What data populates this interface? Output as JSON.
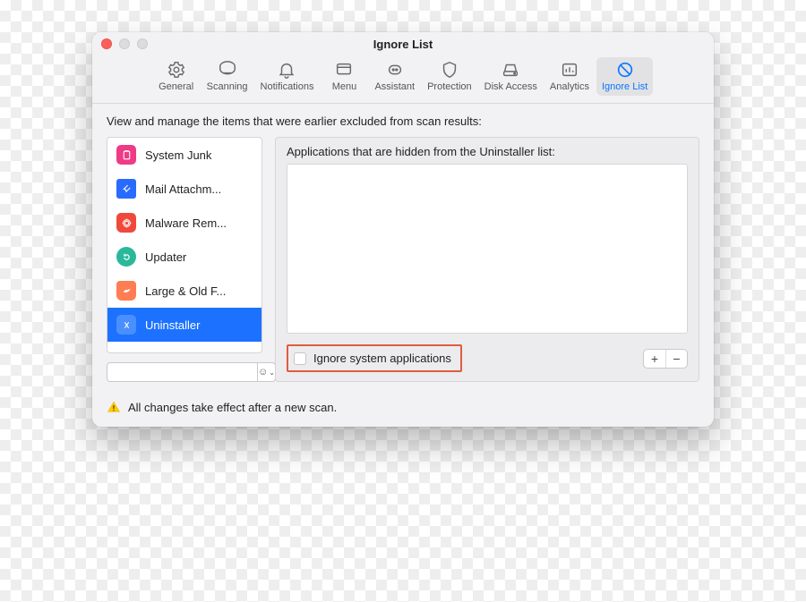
{
  "window": {
    "title": "Ignore List"
  },
  "tabs": [
    {
      "label": "General"
    },
    {
      "label": "Scanning"
    },
    {
      "label": "Notifications"
    },
    {
      "label": "Menu"
    },
    {
      "label": "Assistant"
    },
    {
      "label": "Protection"
    },
    {
      "label": "Disk Access"
    },
    {
      "label": "Analytics"
    },
    {
      "label": "Ignore List"
    }
  ],
  "instructions": "View and manage the items that were earlier excluded from scan results:",
  "sidebar": {
    "items": [
      {
        "label": "System Junk"
      },
      {
        "label": "Mail Attachm..."
      },
      {
        "label": "Malware Rem..."
      },
      {
        "label": "Updater"
      },
      {
        "label": "Large & Old F..."
      },
      {
        "label": "Uninstaller"
      }
    ]
  },
  "main": {
    "heading": "Applications that are hidden from the Uninstaller list:",
    "checkbox_label": "Ignore system applications"
  },
  "footer": {
    "text": "All changes take effect after a new scan."
  }
}
